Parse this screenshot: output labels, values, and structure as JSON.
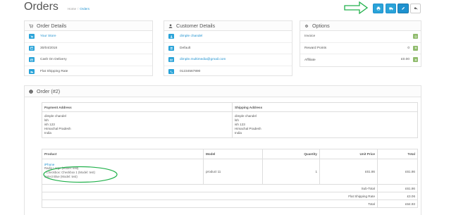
{
  "page": {
    "title": "Orders"
  },
  "breadcrumb": [
    {
      "label": "Home"
    },
    {
      "label": "Orders"
    }
  ],
  "order_details": {
    "title": "Order Details",
    "rows": [
      {
        "icon": "cart-icon",
        "text": "Your Store",
        "link": true
      },
      {
        "icon": "calendar-icon",
        "text": "30/04/2018",
        "link": false
      },
      {
        "icon": "credit-card-icon",
        "text": "Cash On Delivery",
        "link": false
      },
      {
        "icon": "truck-icon",
        "text": "Flat Shipping Rate",
        "link": false
      }
    ]
  },
  "customer_details": {
    "title": "Customer Details",
    "rows": [
      {
        "icon": "user-icon",
        "text": "dimple chandel",
        "link": true
      },
      {
        "icon": "users-icon",
        "text": "Default",
        "link": false
      },
      {
        "icon": "envelope-icon",
        "text": "dimple.multimedia@gmail.com",
        "link": true
      },
      {
        "icon": "phone-icon",
        "text": "01234567890",
        "link": false
      }
    ]
  },
  "options": {
    "title": "Options",
    "rows": [
      {
        "label": "Invoice",
        "value": ""
      },
      {
        "label": "Reward Points",
        "value": "0"
      },
      {
        "label": "Affiliate",
        "value": "£0.00"
      }
    ]
  },
  "order": {
    "title": "Order (#2)",
    "payment_address": {
      "heading": "Payment Address",
      "lines": [
        "dimple chandel",
        "lsh",
        "ish 123",
        "Himachal Pradesh",
        "India"
      ]
    },
    "shipping_address": {
      "heading": "Shipping Address",
      "lines": [
        "dimple chandel",
        "lsh",
        "ish 123",
        "Himachal Pradesh",
        "India"
      ]
    },
    "product_table": {
      "headers": {
        "product": "Product",
        "model": "Model",
        "quantity": "Quantity",
        "unit_price": "Unit Price",
        "total": "Total"
      },
      "items": [
        {
          "name": "iPhone",
          "options": [
            "Radio Large (Model: test)",
            "- Checkbox: Checkbox 1 (Model: test)",
            "Select Blue (Model: test)"
          ],
          "model": "product 11",
          "quantity": "1",
          "unit_price": "£61.86",
          "total": "£61.86"
        }
      ],
      "totals": [
        {
          "label": "Sub-Total",
          "value": "£61.86"
        },
        {
          "label": "Flat Shipping Rate",
          "value": "£3.06"
        },
        {
          "label": "Total",
          "value": "£64.93"
        }
      ]
    }
  }
}
